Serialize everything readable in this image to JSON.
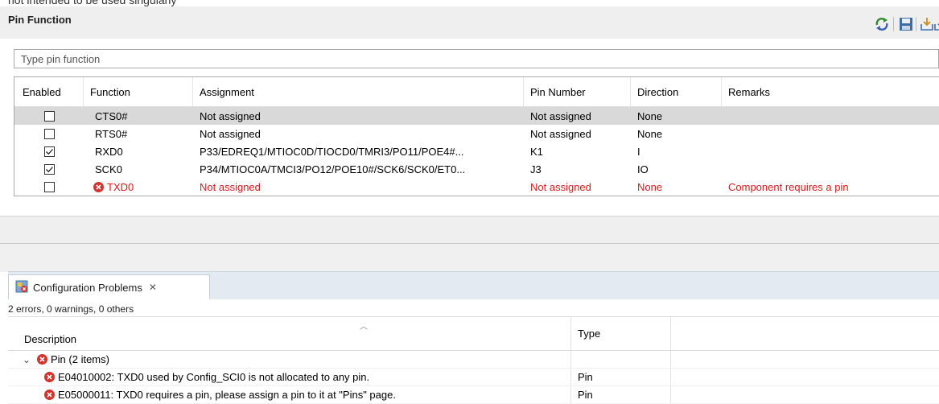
{
  "top_cut_text": "not intended to be used singularly",
  "pin_function": {
    "title": "Pin Function",
    "filter_placeholder": "Type pin function",
    "toolbar": [
      "refresh-icon",
      "save-icon",
      "import-icon",
      "export-icon"
    ],
    "columns": [
      "Enabled",
      "Function",
      "Assignment",
      "Pin Number",
      "Direction",
      "Remarks"
    ],
    "rows": [
      {
        "enabled": false,
        "function": "CTS0#",
        "assignment": "Not assigned",
        "pin_number": "Not assigned",
        "direction": "None",
        "remarks": "",
        "error": false,
        "selected": true
      },
      {
        "enabled": false,
        "function": "RTS0#",
        "assignment": "Not assigned",
        "pin_number": "Not assigned",
        "direction": "None",
        "remarks": "",
        "error": false,
        "selected": false
      },
      {
        "enabled": true,
        "function": "RXD0",
        "assignment": "P33/EDREQ1/MTIOC0D/TIOCD0/TMRI3/PO11/POE4#...",
        "pin_number": "K1",
        "direction": "I",
        "remarks": "",
        "error": false,
        "selected": false
      },
      {
        "enabled": true,
        "function": "SCK0",
        "assignment": "P34/MTIOC0A/TMCI3/PO12/POE10#/SCK6/SCK0/ET0...",
        "pin_number": "J3",
        "direction": "IO",
        "remarks": "",
        "error": false,
        "selected": false
      },
      {
        "enabled": false,
        "function": "TXD0",
        "assignment": "Not assigned",
        "pin_number": "Not assigned",
        "direction": "None",
        "remarks": "Component requires a pin",
        "error": true,
        "selected": false
      }
    ]
  },
  "problems": {
    "tab_label": "Configuration Problems",
    "tab_close": "✕",
    "summary": "2 errors, 0 warnings, 0 others",
    "columns": [
      "Description",
      "Type"
    ],
    "group": "Pin (2 items)",
    "items": [
      {
        "description": "E04010002: TXD0 used by Config_SCI0 is not allocated to any pin.",
        "type": "Pin"
      },
      {
        "description": "E05000011: TXD0 requires a pin, please assign a pin to it at \"Pins\" page.",
        "type": "Pin"
      }
    ]
  },
  "colors": {
    "error": "#e0181b",
    "selected_row": "#d9d9d9",
    "tab_bar": "#e4eaf2"
  }
}
